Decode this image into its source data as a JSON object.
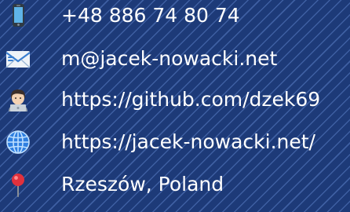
{
  "contacts": {
    "phone": {
      "text": "+48 886 74 80 74",
      "icon": "mobile-phone-icon"
    },
    "email": {
      "text": "m@jacek-nowacki.net",
      "icon": "incoming-envelope-icon"
    },
    "github": {
      "text": "https://github.com/dzek69",
      "icon": "technologist-icon"
    },
    "website": {
      "text": "https://jacek-nowacki.net/",
      "icon": "globe-icon"
    },
    "location": {
      "text": "Rzeszów, Poland",
      "icon": "round-pushpin-icon"
    }
  },
  "colors": {
    "background": "#1d3a78",
    "stripe": "#3e5fa2",
    "text": "#ffffff"
  }
}
